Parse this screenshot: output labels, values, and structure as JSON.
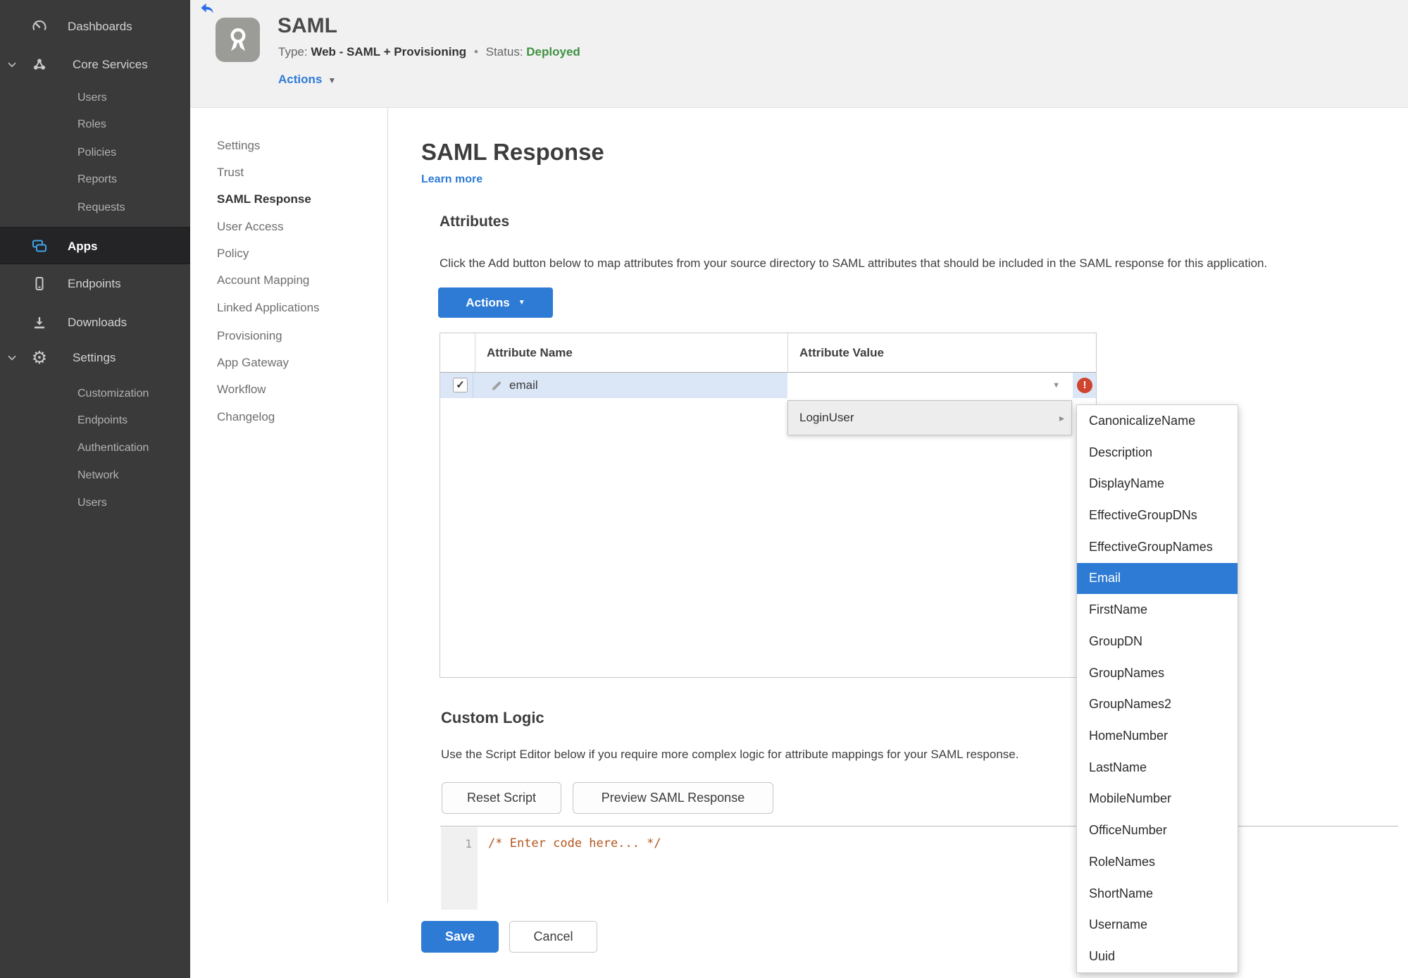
{
  "colors": {
    "accent": "#2e7bd6",
    "status_green": "#3f9140",
    "error_red": "#d0452f",
    "sidebar_bg": "#3a3a3a",
    "row_highlight": "#dbe7f7",
    "code_comment": "#b3561f"
  },
  "sidebar": {
    "dashboards": "Dashboards",
    "core_services": "Core Services",
    "core_sub": [
      "Users",
      "Roles",
      "Policies",
      "Reports",
      "Requests"
    ],
    "apps": "Apps",
    "endpoints": "Endpoints",
    "downloads": "Downloads",
    "settings": "Settings",
    "settings_sub": [
      "Customization",
      "Endpoints",
      "Authentication",
      "Network",
      "Users"
    ]
  },
  "header": {
    "title": "SAML",
    "type_label": "Type:",
    "type_value": "Web - SAML + Provisioning",
    "separator": "•",
    "status_label": "Status:",
    "status_value": "Deployed",
    "actions_label": "Actions"
  },
  "nav": {
    "items": [
      "Settings",
      "Trust",
      "SAML Response",
      "User Access",
      "Policy",
      "Account Mapping",
      "Linked Applications",
      "Provisioning",
      "App Gateway",
      "Workflow",
      "Changelog"
    ],
    "active": "SAML Response"
  },
  "main": {
    "title": "SAML Response",
    "learn_more": "Learn more",
    "attributes": {
      "heading": "Attributes",
      "description": "Click the Add button below to map attributes from your source directory to SAML attributes that should be included in the SAML response for this application.",
      "actions_button": "Actions",
      "table": {
        "columns": [
          "Attribute Name",
          "Attribute Value"
        ],
        "rows": [
          {
            "name": "email",
            "value": "",
            "checked": true,
            "error": true
          }
        ]
      }
    },
    "custom_logic": {
      "heading": "Custom Logic",
      "description": "Use the Script Editor below if you require more complex logic for attribute mappings for your SAML response.",
      "reset_button": "Reset Script",
      "preview_button": "Preview SAML Response",
      "editor": {
        "line_number": "1",
        "code": "/* Enter code here... */"
      }
    },
    "save_button": "Save",
    "cancel_button": "Cancel"
  },
  "dropdown": {
    "item": "LoginUser"
  },
  "submenu": {
    "items": [
      "CanonicalizeName",
      "Description",
      "DisplayName",
      "EffectiveGroupDNs",
      "EffectiveGroupNames",
      "Email",
      "FirstName",
      "GroupDN",
      "GroupNames",
      "GroupNames2",
      "HomeNumber",
      "LastName",
      "MobileNumber",
      "OfficeNumber",
      "RoleNames",
      "ShortName",
      "Username",
      "Uuid"
    ],
    "selected": "Email"
  },
  "icons": {
    "actions_caret": "▼",
    "value_caret": "▼",
    "submenu_arrow": "▸",
    "checkmark": "✓",
    "error_mark": "!"
  }
}
